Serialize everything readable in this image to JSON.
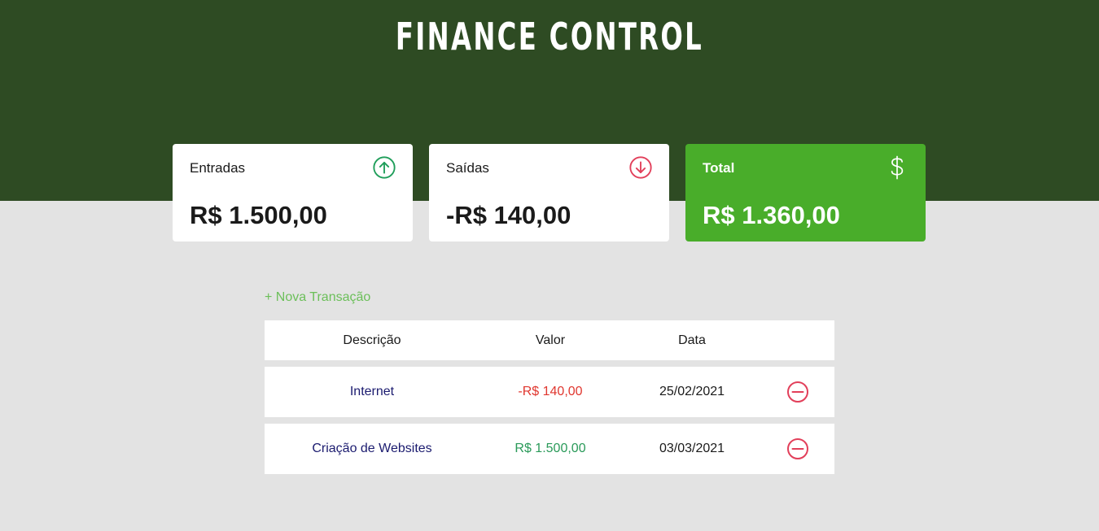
{
  "header": {
    "title": "FINANCE CONTROL"
  },
  "cards": {
    "income": {
      "label": "Entradas",
      "value": "R$ 1.500,00",
      "icon": "arrow-up-circle-icon",
      "icon_color": "#1f9e5a"
    },
    "expense": {
      "label": "Saídas",
      "value": "-R$ 140,00",
      "icon": "arrow-down-circle-icon",
      "icon_color": "#e23f5a"
    },
    "total": {
      "label": "Total",
      "value": "R$ 1.360,00",
      "icon": "dollar-sign-icon",
      "bg_color": "#49ad2a"
    }
  },
  "actions": {
    "new_transaction": "+ Nova Transação"
  },
  "table": {
    "headers": {
      "description": "Descrição",
      "value": "Valor",
      "date": "Data"
    },
    "rows": [
      {
        "description": "Internet",
        "value": "-R$ 140,00",
        "date": "25/02/2021",
        "type": "expense",
        "remove_icon": "minus-circle-icon"
      },
      {
        "description": "Criação de Websites",
        "value": "R$ 1.500,00",
        "date": "03/03/2021",
        "type": "income",
        "remove_icon": "minus-circle-icon"
      }
    ]
  },
  "colors": {
    "header_bg": "#2e4b23",
    "page_bg": "#e3e3e3",
    "accent_green": "#6bbf59",
    "expense_red": "#e0372f",
    "income_green": "#2a9a59",
    "remove_red": "#e23f5a"
  }
}
